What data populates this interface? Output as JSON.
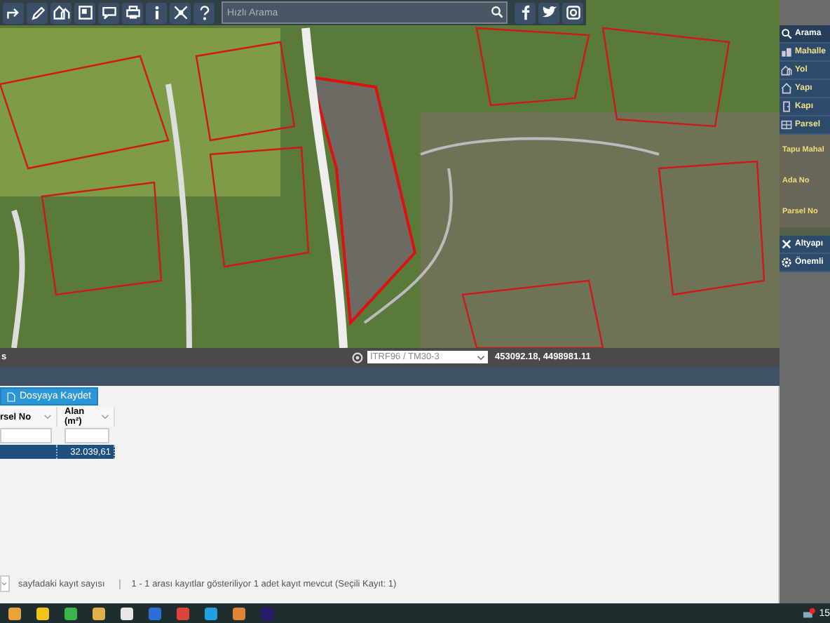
{
  "toolbar": {
    "tools": [
      {
        "kind": "share"
      },
      {
        "kind": "pencil"
      },
      {
        "kind": "houses"
      },
      {
        "kind": "frame"
      },
      {
        "kind": "comment"
      },
      {
        "kind": "print"
      },
      {
        "kind": "info"
      },
      {
        "kind": "cross"
      },
      {
        "kind": "help"
      }
    ],
    "search": {
      "placeholder": "Hızlı Arama"
    },
    "social": [
      {
        "kind": "facebook"
      },
      {
        "kind": "twitter"
      },
      {
        "kind": "instagram"
      }
    ]
  },
  "side_panel": {
    "items": [
      {
        "kind": "search",
        "label": "Arama",
        "selected": true
      },
      {
        "kind": "district",
        "label": "Mahalle",
        "selected": false
      },
      {
        "kind": "road",
        "label": "Yol",
        "selected": false
      },
      {
        "kind": "building",
        "label": "Yapı",
        "selected": false
      },
      {
        "kind": "door",
        "label": "Kapı",
        "selected": false
      },
      {
        "kind": "parcel",
        "label": "Parsel",
        "selected": false
      }
    ],
    "fields": [
      "Tapu Mahal",
      "Ada No",
      "Parsel No"
    ],
    "extra_items": [
      {
        "kind": "tools",
        "label": "Altyapı"
      },
      {
        "kind": "gear",
        "label": "Önemli"
      }
    ]
  },
  "map_status": {
    "left_text": "s",
    "projection": "ITRF96 / TM30-3",
    "coordinates": "453092.18, 4498981.11"
  },
  "results": {
    "save_button": "Dosyaya Kaydet",
    "columns": [
      {
        "label": "rsel No"
      },
      {
        "label": "Alan (m²)"
      }
    ],
    "rows": [
      {
        "cells": [
          "",
          "32.039,61"
        ],
        "selected": true
      }
    ]
  },
  "pager": {
    "page_size_label": "sayfadaki kayıt sayısı",
    "summary": "1 - 1 arası kayıtlar gösteriliyor 1 adet kayıt mevcut (Seçili Kayıt: 1)"
  },
  "taskbar": {
    "apps": [
      {
        "color": "#e8a33c"
      },
      {
        "color": "#f0c419"
      },
      {
        "color": "#39b54a"
      },
      {
        "color": "#e2b04a"
      },
      {
        "color": "#e7e7e7"
      },
      {
        "color": "#2a6fd6"
      },
      {
        "color": "#db4437"
      },
      {
        "color": "#1fa0e0"
      },
      {
        "color": "#e0843a"
      },
      {
        "color": "#2b1b6b"
      }
    ],
    "clock": "15"
  }
}
